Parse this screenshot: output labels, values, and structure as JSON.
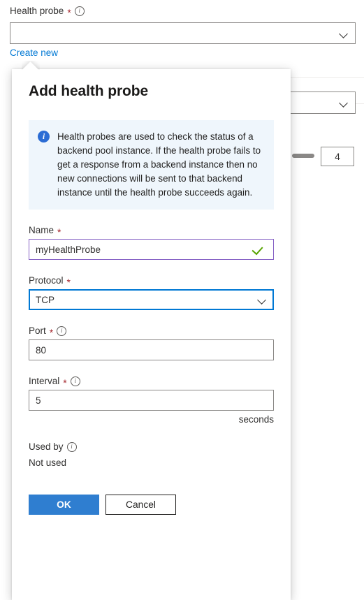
{
  "background": {
    "health_probe_label": "Health probe",
    "required_marker": "*",
    "info_icon_glyph": "i",
    "create_new_link": "Create new",
    "chevron_icon": "chevron-down-icon",
    "secondary_select_value": "",
    "number_box_value": "4",
    "slider_icon": "slider-handle"
  },
  "callout": {
    "title": "Add health probe",
    "info_bar": {
      "icon": "info-icon",
      "icon_glyph": "i",
      "text": "Health probes are used to check the status of a backend pool instance. If the health probe fails to get a response from a backend instance then no new connections will be sent to that backend instance until the health probe succeeds again."
    },
    "fields": {
      "name": {
        "label": "Name",
        "required_marker": "*",
        "value": "myHealthProbe",
        "placeholder": "",
        "validation_icon": "checkmark-icon",
        "state": "valid"
      },
      "protocol": {
        "label": "Protocol",
        "required_marker": "*",
        "value": "TCP",
        "chevron_icon": "chevron-down-icon",
        "state": "focused"
      },
      "port": {
        "label": "Port",
        "required_marker": "*",
        "info_icon": "info-icon",
        "info_icon_glyph": "i",
        "value": "80",
        "placeholder": ""
      },
      "interval": {
        "label": "Interval",
        "required_marker": "*",
        "info_icon": "info-icon",
        "info_icon_glyph": "i",
        "value": "5",
        "placeholder": "",
        "suffix": "seconds"
      },
      "used_by": {
        "label": "Used by",
        "info_icon": "info-icon",
        "info_icon_glyph": "i",
        "value": "Not used"
      }
    },
    "actions": {
      "ok_label": "OK",
      "cancel_label": "Cancel"
    }
  },
  "colors": {
    "accent_blue": "#0078d4",
    "primary_button": "#2f7ed0",
    "link_blue": "#0078d4",
    "required_red": "#a4262c",
    "valid_purple": "#8661c5",
    "valid_green": "#57a300",
    "info_bar_bg": "#eff6fc",
    "info_icon_blue": "#2b6cd4",
    "border_gray": "#8a8886"
  }
}
